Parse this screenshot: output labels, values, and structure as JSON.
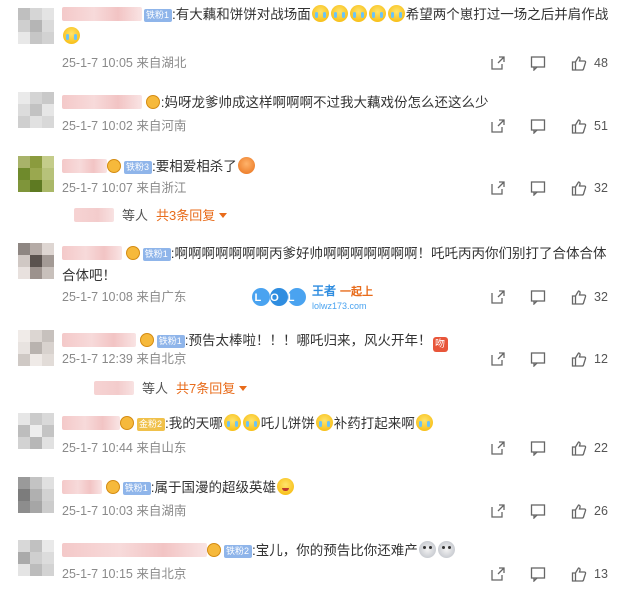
{
  "comments": [
    {
      "badge": "铁粉1",
      "badge_style": "blue",
      "text_before": ":有大藕和饼饼对战场面",
      "text_after": "希望两个崽打过一场之后并肩作战",
      "time": "25-1-7 10:05",
      "location": "来自湖北",
      "likes": "48"
    },
    {
      "badge": "",
      "text_before": ":妈呀龙爹帅成这样啊啊啊不过我大藕戏份怎么还这么少",
      "text_after": "",
      "time": "25-1-7 10:02",
      "location": "来自河南",
      "likes": "51"
    },
    {
      "badge": "铁粉3",
      "badge_style": "blue",
      "text_before": ":要相爱相杀了",
      "text_after": "",
      "time": "25-1-7 10:07",
      "location": "来自浙江",
      "likes": "32",
      "replies": {
        "suffix": "等人",
        "more": "共3条回复"
      }
    },
    {
      "badge": "铁粉1",
      "badge_style": "blue",
      "text_before": ":啊啊啊啊啊啊啊丙爹好帅啊啊啊啊啊啊啊！吒吒丙丙你们别打了合体合体合体吧！",
      "text_after": "",
      "time": "25-1-7 10:08",
      "location": "来自广东",
      "likes": "32"
    },
    {
      "badge": "铁粉1",
      "badge_style": "blue",
      "text_before": ":预告太棒啦！！！哪吒归来，风火开年！",
      "text_after": "",
      "time": "25-1-7 12:39",
      "location": "来自北京",
      "likes": "12",
      "replies": {
        "suffix": "等人",
        "more": "共7条回复"
      }
    },
    {
      "badge": "金粉2",
      "badge_style": "gold",
      "text_before": ":我的天哪",
      "text_mid": "吒儿饼饼",
      "text_after": "补药打起来啊",
      "time": "25-1-7 10:44",
      "location": "来自山东",
      "likes": "22"
    },
    {
      "badge": "铁粉1",
      "badge_style": "blue",
      "text_before": ":属于国漫的超级英雄",
      "text_after": "",
      "time": "25-1-7 10:03",
      "location": "来自湖南",
      "likes": "26"
    },
    {
      "badge": "铁粉2",
      "badge_style": "blue",
      "text_before": ":宝儿，你的预告比你还难产",
      "text_after": "",
      "time": "25-1-7 10:15",
      "location": "来自北京",
      "likes": "13"
    }
  ],
  "emoji_fire_label": "吻",
  "watermark": {
    "lol": "LOL",
    "wz": "王者",
    "tag": "一起上",
    "url": "lolwz173.com"
  },
  "icons": {
    "share": "share-icon",
    "comment": "comment-icon",
    "like": "thumbs-up-icon"
  },
  "colors": {
    "accent": "#e86b1a",
    "meta": "#8a8a8a",
    "badge_blue": "#8fb5ea",
    "badge_gold": "#f0c14b"
  }
}
